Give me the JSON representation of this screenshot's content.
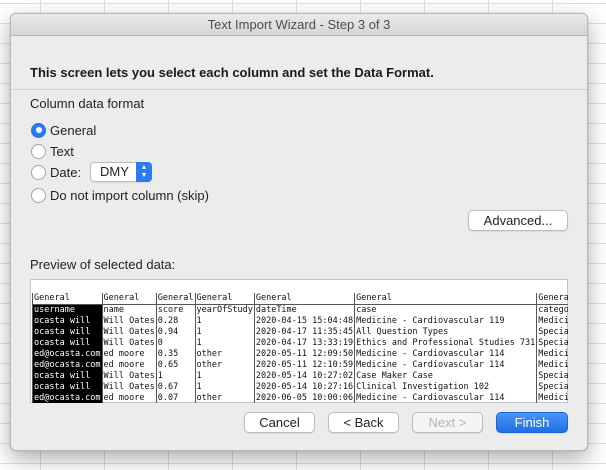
{
  "window": {
    "title": "Text Import Wizard - Step 3 of 3"
  },
  "intro": "This screen lets you select each column and set the Data Format.",
  "format": {
    "section_label": "Column data format",
    "general": "General",
    "text": "Text",
    "date": "Date:",
    "date_value": "DMY",
    "skip": "Do not import column (skip)",
    "selected": "General"
  },
  "advanced_label": "Advanced...",
  "preview": {
    "label": "Preview of selected data:",
    "header": [
      "General",
      "General",
      "General",
      "General",
      "General",
      "General",
      "General"
    ],
    "rows": [
      [
        "username",
        "name",
        "score",
        "yearOfStudy",
        "dateTime",
        "case",
        "category"
      ],
      [
        "ocasta will",
        "Will Oates",
        "0.28",
        "1",
        "2020-04-15 15:04:48",
        "Medicine - Cardiovascular 119",
        "Medicine"
      ],
      [
        "ocasta will",
        "Will Oates",
        "0.94",
        "1",
        "2020-04-17 11:35:45",
        "All Question Types",
        "Specialt"
      ],
      [
        "ocasta will",
        "Will Oates",
        "0",
        "1",
        "2020-04-17 13:33:19",
        "Ethics and Professional Studies 731",
        "Specialt"
      ],
      [
        "ed@ocasta.com",
        "ed moore",
        "0.35",
        "other",
        "2020-05-11 12:09:50",
        "Medicine - Cardiovascular 114",
        "Medicine"
      ],
      [
        "ed@ocasta.com",
        "ed moore",
        "0.65",
        "other",
        "2020-05-11 12:10:59",
        "Medicine - Cardiovascular 114",
        "Medicine"
      ],
      [
        "ocasta will",
        "Will Oates",
        "1",
        "1",
        "2020-05-14 10:27:02",
        "Case Maker Case",
        "Specialt"
      ],
      [
        "ocasta will",
        "Will Oates",
        "0.67",
        "1",
        "2020-05-14 10:27:16",
        "Clinical Investigation 102",
        "Specialt"
      ],
      [
        "ed@ocasta.com",
        "ed moore",
        "0.07",
        "other",
        "2020-06-05 10:00:06",
        "Medicine - Cardiovascular 114",
        "Medicine"
      ]
    ]
  },
  "buttons": {
    "cancel": "Cancel",
    "back": "< Back",
    "next": "Next >",
    "finish": "Finish"
  }
}
